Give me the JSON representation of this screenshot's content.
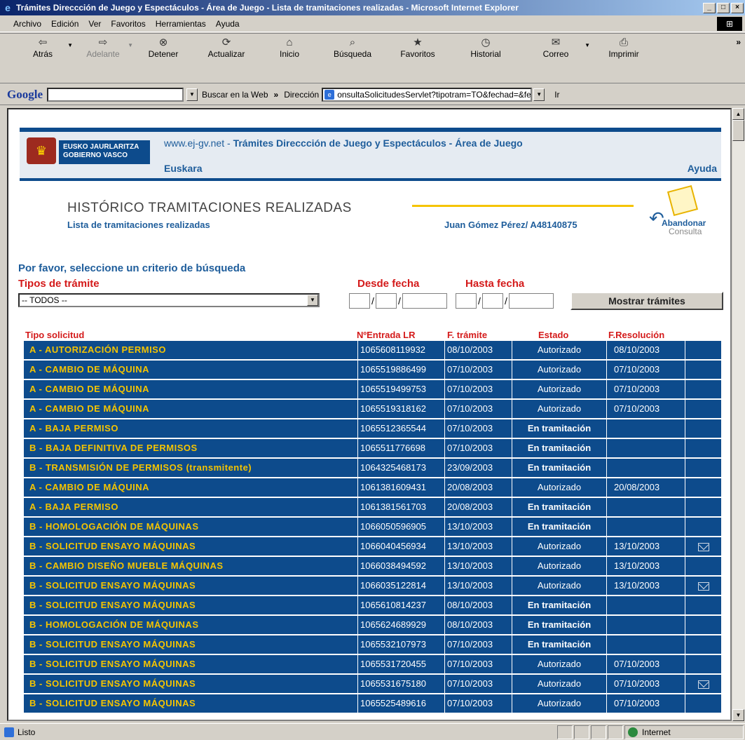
{
  "window": {
    "title": "Trámites Direccción de Juego y Espectáculos - Área de Juego - Lista de tramitaciones realizadas - Microsoft Internet Explorer"
  },
  "menu": [
    "Archivo",
    "Edición",
    "Ver",
    "Favoritos",
    "Herramientas",
    "Ayuda"
  ],
  "toolbar": {
    "buttons": [
      {
        "label": "Atrás",
        "icon": "back-arrow-icon",
        "glyph": "⇦"
      },
      {
        "label": "Adelante",
        "icon": "forward-arrow-icon",
        "glyph": "⇨"
      },
      {
        "label": "Detener",
        "icon": "stop-icon",
        "glyph": "⊗"
      },
      {
        "label": "Actualizar",
        "icon": "refresh-icon",
        "glyph": "⟳"
      },
      {
        "label": "Inicio",
        "icon": "home-icon",
        "glyph": "⌂"
      },
      {
        "label": "Búsqueda",
        "icon": "search-icon",
        "glyph": "⌕"
      },
      {
        "label": "Favoritos",
        "icon": "favorites-icon",
        "glyph": "★"
      },
      {
        "label": "Historial",
        "icon": "history-icon",
        "glyph": "◷"
      },
      {
        "label": "Correo",
        "icon": "mail-icon",
        "glyph": "✉"
      },
      {
        "label": "Imprimir",
        "icon": "print-icon",
        "glyph": "⎙"
      }
    ],
    "more": "»"
  },
  "addressbar": {
    "google": "Google",
    "buscar": "Buscar en la Web",
    "direccion_label": "Dirección",
    "url": "onsultaSolicitudesServlet?tipotram=TO&fechad=&fechah=",
    "ir": "Ir"
  },
  "header": {
    "logo_line1": "EUSKO JAURLARITZA",
    "logo_line2": "GOBIERNO VASCO",
    "site_url": "www.ej-gv.net",
    "site_title": "Trámites Direccción de Juego y Espectáculos - Área de Juego",
    "euskara": "Euskara",
    "ayuda": "Ayuda"
  },
  "page": {
    "title": "HISTÓRICO TRAMITACIONES REALIZADAS",
    "subtitle": "Lista de tramitaciones realizadas",
    "user": "Juan Gómez Pérez/ A48140875",
    "abandonar_line1": "Abandonar",
    "abandonar_line2": "Consulta",
    "criterio": "Por favor, seleccione un criterio de búsqueda",
    "tipos_label": "Tipos de trámite",
    "tipos_selected": "-- TODOS --",
    "desde_label": "Desde fecha",
    "hasta_label": "Hasta fecha",
    "mostrar_button": "Mostrar trámites"
  },
  "table": {
    "headers": {
      "tipo": "Tipo solicitud",
      "entrada": "NºEntrada LR",
      "fecha": "F. trámite",
      "estado": "Estado",
      "resolucion": "F.Resolución"
    },
    "rows": [
      {
        "tipo": "A - AUTORIZACIÓN PERMISO",
        "entrada": "1065608119932",
        "fecha": "08/10/2003",
        "estado": "Autorizado",
        "resolucion": "08/10/2003",
        "envelope": false
      },
      {
        "tipo": "A - CAMBIO DE MÁQUINA",
        "entrada": "1065519886499",
        "fecha": "07/10/2003",
        "estado": "Autorizado",
        "resolucion": "07/10/2003",
        "envelope": false
      },
      {
        "tipo": "A - CAMBIO DE MÁQUINA",
        "entrada": "1065519499753",
        "fecha": "07/10/2003",
        "estado": "Autorizado",
        "resolucion": "07/10/2003",
        "envelope": false
      },
      {
        "tipo": "A - CAMBIO DE MÁQUINA",
        "entrada": "1065519318162",
        "fecha": "07/10/2003",
        "estado": "Autorizado",
        "resolucion": "07/10/2003",
        "envelope": false
      },
      {
        "tipo": "A - BAJA PERMISO",
        "entrada": "1065512365544",
        "fecha": "07/10/2003",
        "estado": "En tramitación",
        "resolucion": "",
        "envelope": false
      },
      {
        "tipo": "B - BAJA DEFINITIVA DE PERMISOS",
        "entrada": "1065511776698",
        "fecha": "07/10/2003",
        "estado": "En tramitación",
        "resolucion": "",
        "envelope": false
      },
      {
        "tipo": "B - TRANSMISIÓN DE PERMISOS (transmitente)",
        "entrada": "1064325468173",
        "fecha": "23/09/2003",
        "estado": "En tramitación",
        "resolucion": "",
        "envelope": false
      },
      {
        "tipo": "A - CAMBIO DE MÁQUINA",
        "entrada": "1061381609431",
        "fecha": "20/08/2003",
        "estado": "Autorizado",
        "resolucion": "20/08/2003",
        "envelope": false
      },
      {
        "tipo": "A - BAJA PERMISO",
        "entrada": "1061381561703",
        "fecha": "20/08/2003",
        "estado": "En tramitación",
        "resolucion": "",
        "envelope": false
      },
      {
        "tipo": "B - HOMOLOGACIÓN DE MÁQUINAS",
        "entrada": "1066050596905",
        "fecha": "13/10/2003",
        "estado": "En tramitación",
        "resolucion": "",
        "envelope": false
      },
      {
        "tipo": "B - SOLICITUD ENSAYO MÁQUINAS",
        "entrada": "1066040456934",
        "fecha": "13/10/2003",
        "estado": "Autorizado",
        "resolucion": "13/10/2003",
        "envelope": true
      },
      {
        "tipo": "B - CAMBIO DISEÑO MUEBLE MÁQUINAS",
        "entrada": "1066038494592",
        "fecha": "13/10/2003",
        "estado": "Autorizado",
        "resolucion": "13/10/2003",
        "envelope": false
      },
      {
        "tipo": "B - SOLICITUD ENSAYO MÁQUINAS",
        "entrada": "1066035122814",
        "fecha": "13/10/2003",
        "estado": "Autorizado",
        "resolucion": "13/10/2003",
        "envelope": true
      },
      {
        "tipo": "B - SOLICITUD ENSAYO MÁQUINAS",
        "entrada": "1065610814237",
        "fecha": "08/10/2003",
        "estado": "En tramitación",
        "resolucion": "",
        "envelope": false
      },
      {
        "tipo": "B - HOMOLOGACIÓN DE MÁQUINAS",
        "entrada": "1065624689929",
        "fecha": "08/10/2003",
        "estado": "En tramitación",
        "resolucion": "",
        "envelope": false
      },
      {
        "tipo": "B - SOLICITUD ENSAYO MÁQUINAS",
        "entrada": "1065532107973",
        "fecha": "07/10/2003",
        "estado": "En tramitación",
        "resolucion": "",
        "envelope": false
      },
      {
        "tipo": "B - SOLICITUD ENSAYO MÁQUINAS",
        "entrada": "1065531720455",
        "fecha": "07/10/2003",
        "estado": "Autorizado",
        "resolucion": "07/10/2003",
        "envelope": false
      },
      {
        "tipo": "B - SOLICITUD ENSAYO MÁQUINAS",
        "entrada": "1065531675180",
        "fecha": "07/10/2003",
        "estado": "Autorizado",
        "resolucion": "07/10/2003",
        "envelope": true
      },
      {
        "tipo": "B - SOLICITUD ENSAYO MÁQUINAS",
        "entrada": "1065525489616",
        "fecha": "07/10/2003",
        "estado": "Autorizado",
        "resolucion": "07/10/2003",
        "envelope": false
      }
    ]
  },
  "statusbar": {
    "status": "Listo",
    "zone": "Internet"
  },
  "colors": {
    "row_bg": "#0d4b8c",
    "tipo_text": "#f5c400",
    "header_red": "#d41a1a",
    "link_blue": "#1e5d9b"
  }
}
